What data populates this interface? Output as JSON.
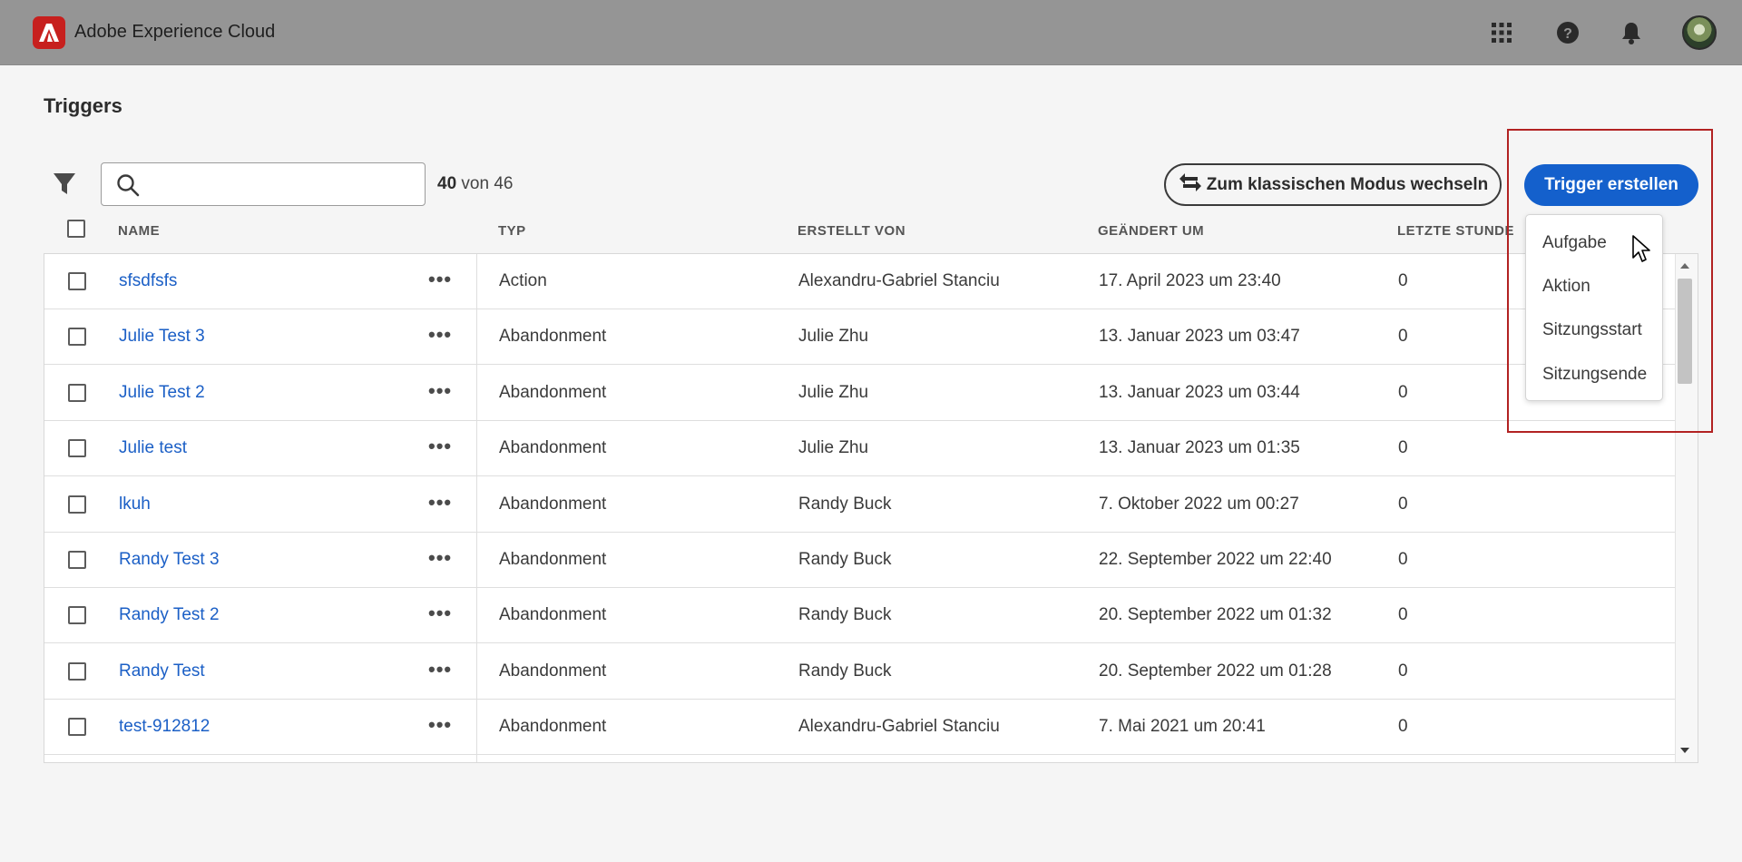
{
  "header": {
    "app_title": "Adobe Experience Cloud",
    "icons": [
      "adobe-logo-icon",
      "apps-grid-icon",
      "help-icon",
      "bell-icon",
      "avatar"
    ]
  },
  "page": {
    "title": "Triggers"
  },
  "toolbar": {
    "search_placeholder": "",
    "count_shown": "40",
    "count_rest": "von 46",
    "switch_label": "Zum klassischen Modus wechseln",
    "create_label": "Trigger erstellen"
  },
  "menu": {
    "items": [
      "Aufgabe",
      "Aktion",
      "Sitzungsstart",
      "Sitzungsende"
    ]
  },
  "table": {
    "columns": [
      "NAME",
      "TYP",
      "ERSTELLT VON",
      "GEÄNDERT UM",
      "LETZTE STUNDE"
    ],
    "rows": [
      {
        "name": "sfsdfsfs",
        "type": "Action",
        "created_by": "Alexandru-Gabriel Stanciu",
        "modified": "17. April 2023 um 23:40",
        "last_hour": "0"
      },
      {
        "name": "Julie Test 3",
        "type": "Abandonment",
        "created_by": "Julie Zhu",
        "modified": "13. Januar 2023 um 03:47",
        "last_hour": "0"
      },
      {
        "name": "Julie Test 2",
        "type": "Abandonment",
        "created_by": "Julie Zhu",
        "modified": "13. Januar 2023 um 03:44",
        "last_hour": "0"
      },
      {
        "name": "Julie test",
        "type": "Abandonment",
        "created_by": "Julie Zhu",
        "modified": "13. Januar 2023 um 01:35",
        "last_hour": "0"
      },
      {
        "name": "lkuh",
        "type": "Abandonment",
        "created_by": "Randy Buck",
        "modified": "7. Oktober 2022 um 00:27",
        "last_hour": "0"
      },
      {
        "name": "Randy Test 3",
        "type": "Abandonment",
        "created_by": "Randy Buck",
        "modified": "22. September 2022 um 22:40",
        "last_hour": "0"
      },
      {
        "name": "Randy Test 2",
        "type": "Abandonment",
        "created_by": "Randy Buck",
        "modified": "20. September 2022 um 01:32",
        "last_hour": "0"
      },
      {
        "name": "Randy Test",
        "type": "Abandonment",
        "created_by": "Randy Buck",
        "modified": "20. September 2022 um 01:28",
        "last_hour": "0"
      },
      {
        "name": "test-912812",
        "type": "Abandonment",
        "created_by": "Alexandru-Gabriel Stanciu",
        "modified": "7. Mai 2021 um 20:41",
        "last_hour": "0"
      }
    ]
  },
  "colors": {
    "header_bg": "#959595",
    "accent": "#1460cc",
    "link": "#1b5fc6",
    "highlight": "#b22222",
    "logo": "#c7201e"
  }
}
